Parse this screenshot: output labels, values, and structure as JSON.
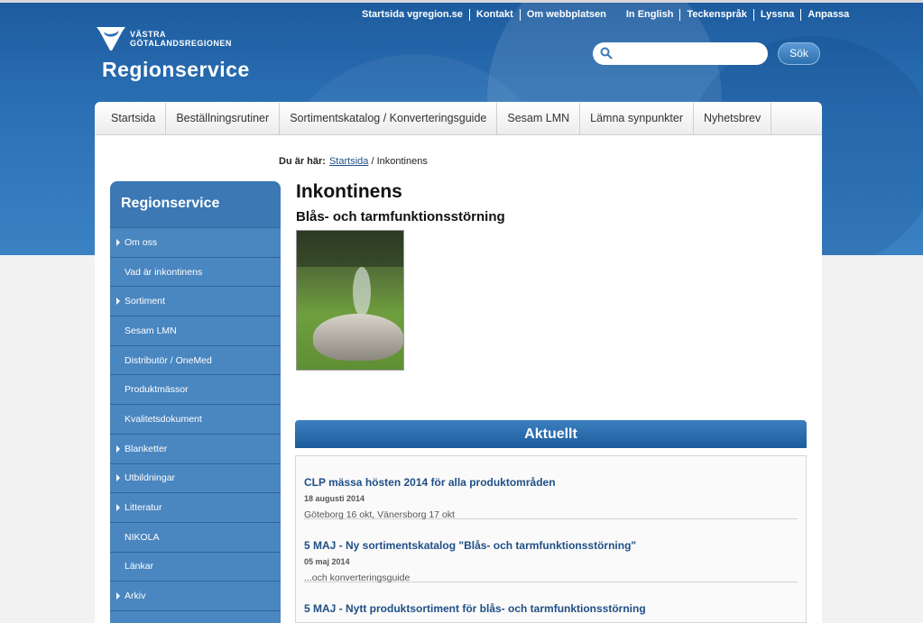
{
  "header": {
    "top_links": [
      "Startsida vgregion.se",
      "Kontakt",
      "Om webbplatsen",
      "In English",
      "Teckenspråk",
      "Lyssna",
      "Anpassa"
    ],
    "logo_line1": "VÄSTRA",
    "logo_line2": "GÖTALANDSREGIONEN",
    "site_name": "Regionservice",
    "search": {
      "placeholder": "",
      "button_label": "Sök"
    }
  },
  "nav": {
    "items": [
      "Startsida",
      "Beställningsrutiner",
      "Sortimentskatalog / Konverteringsguide",
      "Sesam LMN",
      "Lämna synpunkter",
      "Nyhetsbrev"
    ]
  },
  "breadcrumb": {
    "label": "Du är här:",
    "home": "Startsida",
    "separator": " / ",
    "current": "Inkontinens"
  },
  "sidebar": {
    "title": "Regionservice",
    "items": [
      {
        "label": "Om oss",
        "expandable": true
      },
      {
        "label": "Vad är inkontinens",
        "expandable": false
      },
      {
        "label": "Sortiment",
        "expandable": true
      },
      {
        "label": "Sesam LMN",
        "expandable": false
      },
      {
        "label": "Distributör / OneMed",
        "expandable": false
      },
      {
        "label": "Produktmässor",
        "expandable": false
      },
      {
        "label": "Kvalitetsdokument",
        "expandable": false
      },
      {
        "label": "Blanketter",
        "expandable": true
      },
      {
        "label": "Utbildningar",
        "expandable": true
      },
      {
        "label": "Litteratur",
        "expandable": true
      },
      {
        "label": "NIKOLA",
        "expandable": false
      },
      {
        "label": "Länkar",
        "expandable": false
      },
      {
        "label": "Arkiv",
        "expandable": true
      }
    ]
  },
  "main": {
    "title": "Inkontinens",
    "subtitle": "Blås- och tarmfunktionsstörning"
  },
  "news": {
    "heading": "Aktuellt",
    "items": [
      {
        "title": "CLP mässa hösten 2014 för alla produktområden",
        "date": "18 augusti 2014",
        "text": "Göteborg 16 okt, Vänersborg 17 okt"
      },
      {
        "title": "5 MAJ - Ny sortimentskatalog \"Blås- och tarmfunktionsstörning\"",
        "date": "05 maj 2014",
        "text": "...och konverteringsguide"
      },
      {
        "title": "5 MAJ - Nytt produktsortiment för blås- och tarmfunktionsstörning",
        "date": "",
        "text": ""
      }
    ]
  },
  "colors": {
    "header_blue": "#2a6fb3",
    "sidebar_blue": "#4a86c0",
    "link_blue": "#1f4f86"
  }
}
